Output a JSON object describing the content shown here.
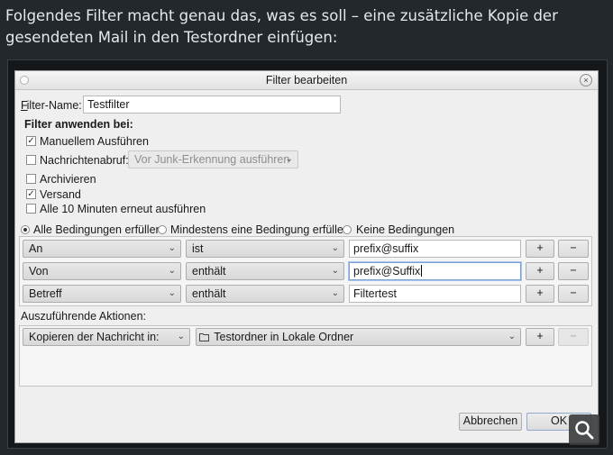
{
  "intro_text": "Folgendes Filter macht genau das, was es soll – eine zusätzliche Kopie der gesendeten Mail in den Testordner einfügen:",
  "dialog": {
    "title": "Filter bearbeiten",
    "filter_name_label": "Filter-Name:",
    "filter_name_value": "Testfilter",
    "apply_heading": "Filter anwenden bei:",
    "options": {
      "manual": "Manuellem Ausführen",
      "fetch": "Nachrichtenabruf:",
      "fetch_select": "Vor Junk-Erkennung ausführen",
      "archive": "Archivieren",
      "send": "Versand",
      "periodic": "Alle 10 Minuten erneut ausführen"
    },
    "match": {
      "all": "Alle Bedingungen erfüllen",
      "any": "Mindestens eine Bedingung erfüllen",
      "none": "Keine Bedingungen"
    },
    "conditions": [
      {
        "field": "An",
        "operator": "ist",
        "value": "prefix@suffix"
      },
      {
        "field": "Von",
        "operator": "enthält",
        "value": "prefix@Suffix"
      },
      {
        "field": "Betreff",
        "operator": "enthält",
        "value": "Filtertest"
      }
    ],
    "add_symbol": "+",
    "remove_symbol": "−",
    "actions_label": "Auszuführende Aktionen:",
    "action": {
      "type": "Kopieren der Nachricht in:",
      "target": "Testordner in Lokale Ordner"
    },
    "cancel_label": "Abbrechen",
    "ok_label": "OK",
    "close_glyph": "×"
  }
}
